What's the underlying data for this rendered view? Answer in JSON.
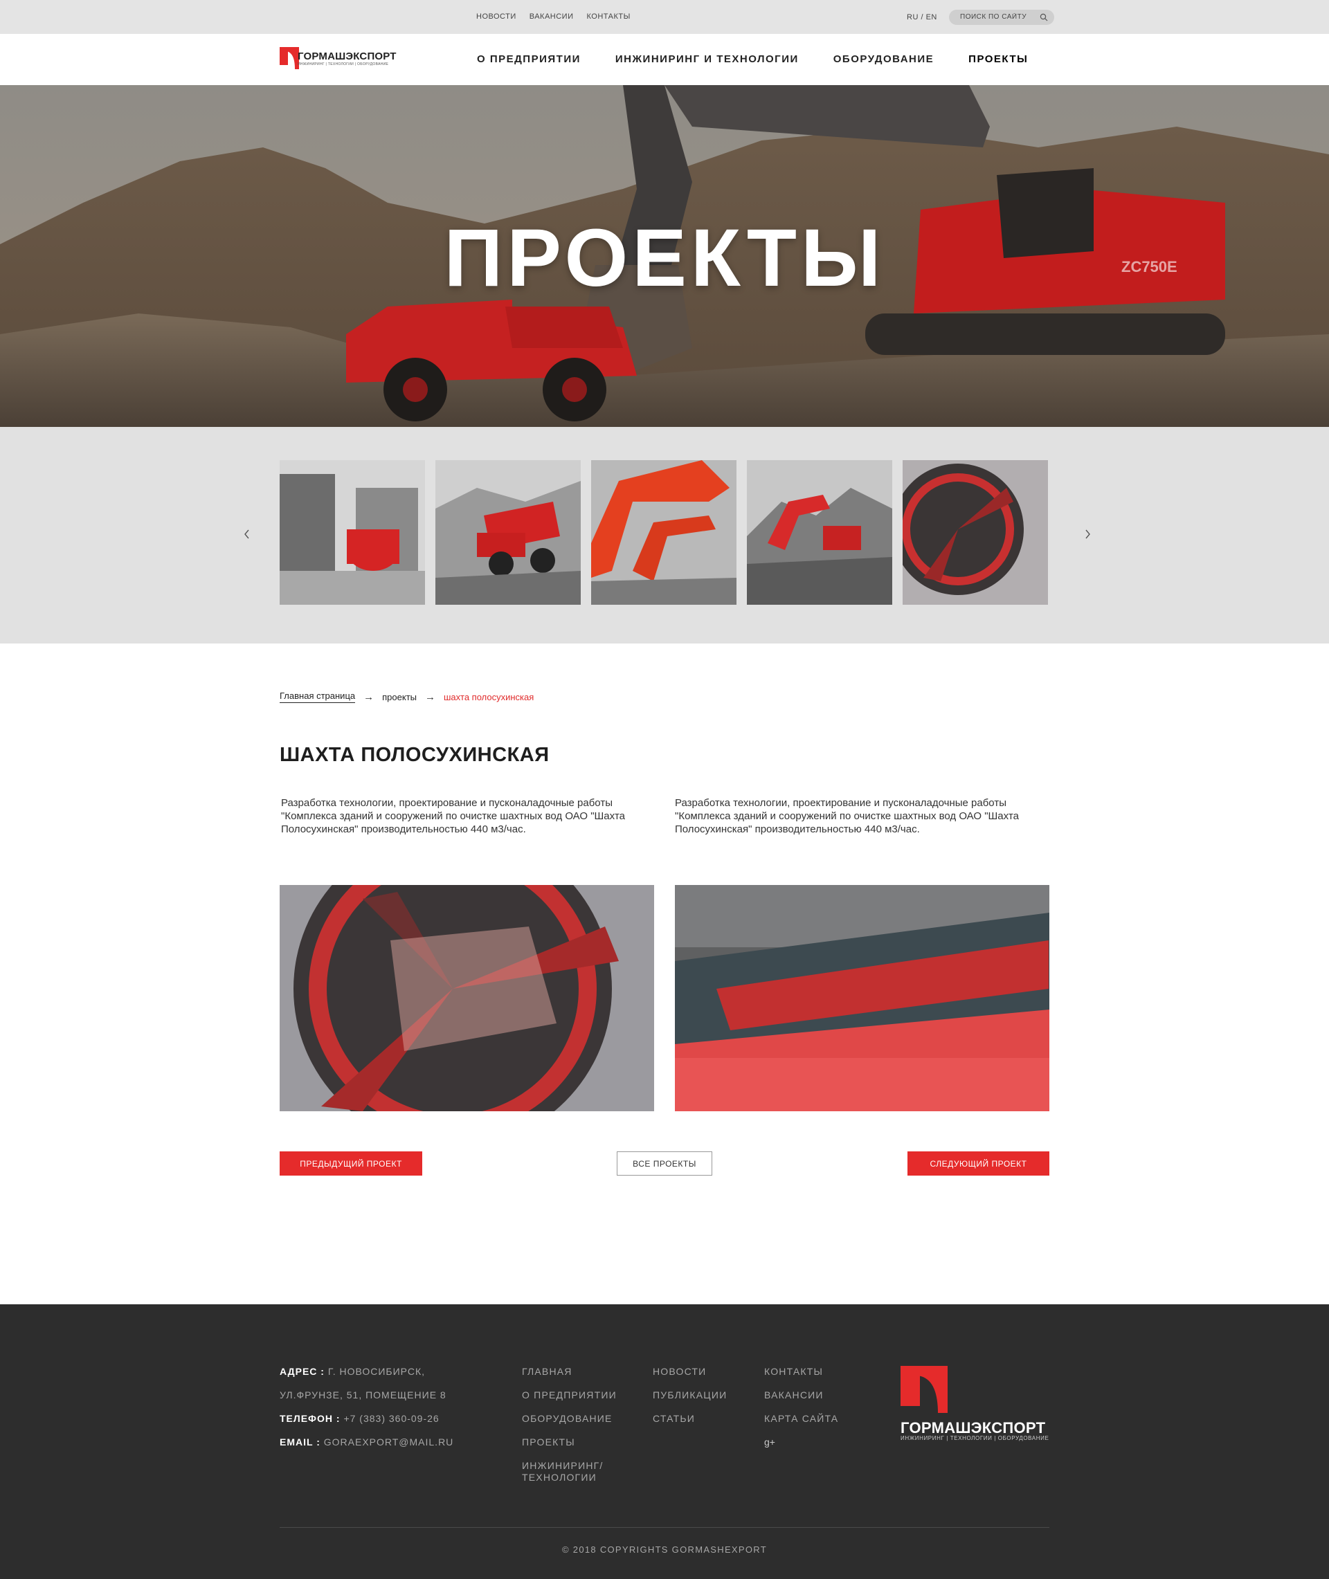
{
  "topbar": {
    "links": [
      "НОВОСТИ",
      "ВАКАНСИИ",
      "КОНТАКТЫ"
    ],
    "lang_ru": "RU",
    "lang_sep": "/",
    "lang_en": "EN",
    "search_placeholder": "ПОИСК ПО САЙТУ"
  },
  "header": {
    "logo_text": "ГОРМАШЭКСПОРТ",
    "logo_sub": "ИНЖИНИРИНГ | ТЕХНОЛОГИИ | ОБОРУДОВАНИЕ",
    "nav": [
      "О ПРЕДПРИЯТИИ",
      "ИНЖИНИРИНГ И ТЕХНОЛОГИИ",
      "ОБОРУДОВАНИЕ",
      "ПРОЕКТЫ"
    ],
    "active_nav": "ПРОЕКТЫ"
  },
  "hero": {
    "title": "ПРОЕКТЫ",
    "machine_label": "ZC750E"
  },
  "breadcrumb": {
    "home": "Главная страница",
    "section": "проекты",
    "current": "шахта полосухинская"
  },
  "project": {
    "title": "ШАХТА ПОЛОСУХИНСКАЯ",
    "desc_left": "Разработка технологии, проектирование и пусконаладочные работы \"Комплекса зданий и сооружений по очистке шахтных вод ОАО \"Шахта Полосухинская\" производительностью 440 м3/час.",
    "desc_right": "Разработка технологии, проектирование и пусконаладочные работы \"Комплекса зданий и сооружений по очистке шахтных вод ОАО \"Шахта Полосухинская\" производительностью 440 м3/час."
  },
  "buttons": {
    "prev": "ПРЕДЫДУЩИЙ ПРОЕКТ",
    "all": "ВСЕ ПРОЕКТЫ",
    "next": "СЛЕДУЮЩИЙ ПРОЕКТ"
  },
  "footer": {
    "address_label": "АДРЕС :",
    "address_line1": "Г. НОВОСИБИРСК,",
    "address_line2": "УЛ.ФРУНЗЕ, 51, ПОМЕЩЕНИЕ 8",
    "phone_label": "ТЕЛЕФОН :",
    "phone": "+7 (383) 360-09-26",
    "email_label": "EMAIL :",
    "email": "GORAEXPORT@MAIL.RU",
    "col1": [
      "ГЛАВНАЯ",
      "О ПРЕДПРИЯТИИ",
      "ОБОРУДОВАНИЕ",
      "ПРОЕКТЫ",
      "ИНЖИНИРИНГ/ ТЕХНОЛОГИИ"
    ],
    "col2": [
      "НОВОСТИ",
      "ПУБЛИКАЦИИ",
      "СТАТЬИ"
    ],
    "col3": [
      "КОНТАКТЫ",
      "ВАКАНСИИ",
      "КАРТА САЙТА"
    ],
    "social_icon": "google-plus-icon",
    "social_glyph": "g+",
    "logo_text": "ГОРМАШЭКСПОРТ",
    "logo_sub": "ИНЖИНИРИНГ | ТЕХНОЛОГИИ | ОБОРУДОВАНИЕ",
    "copyright": "© 2018 COPYRIGHTS GORMASHEXPORT"
  },
  "colors": {
    "accent": "#e52b2b",
    "footer_bg": "#2d2d2d",
    "gallery_bg": "#e1e1e1",
    "topbar_bg": "#e4e4e4"
  }
}
